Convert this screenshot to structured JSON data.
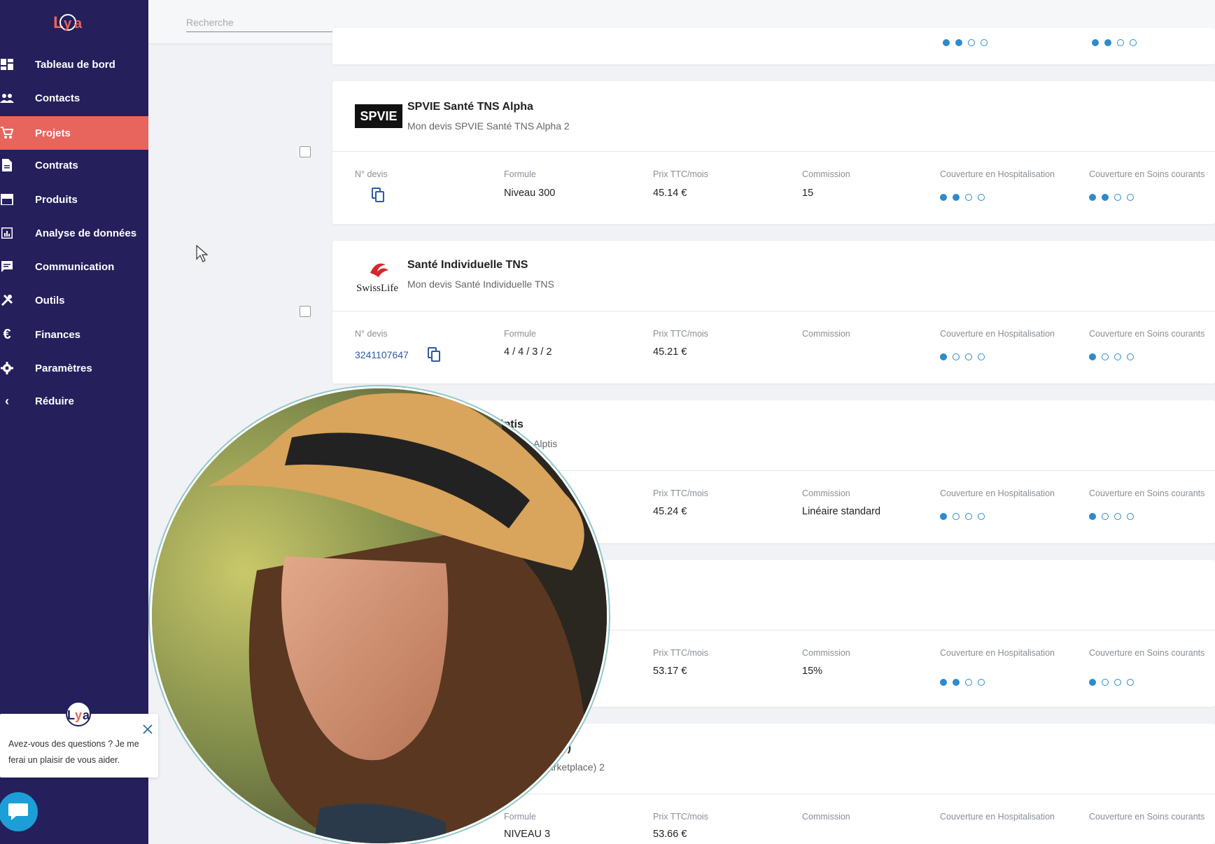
{
  "app": {
    "logo_text": "Lya"
  },
  "sidebar": {
    "items": [
      {
        "label": "Tableau de bord",
        "icon": "dashboard-icon",
        "active": false
      },
      {
        "label": "Contacts",
        "icon": "people-icon",
        "active": false
      },
      {
        "label": "Projets",
        "icon": "cart-icon",
        "active": true
      },
      {
        "label": "Contrats",
        "icon": "document-icon",
        "active": false
      },
      {
        "label": "Produits",
        "icon": "store-icon",
        "active": false
      },
      {
        "label": "Analyse de données",
        "icon": "chart-icon",
        "active": false
      },
      {
        "label": "Communication",
        "icon": "message-icon",
        "active": false
      },
      {
        "label": "Outils",
        "icon": "tools-icon",
        "active": false
      },
      {
        "label": "Finances",
        "icon": "euro-icon",
        "active": false
      },
      {
        "label": "Paramètres",
        "icon": "gear-icon",
        "active": false
      },
      {
        "label": "Réduire",
        "icon": "chevron-left-icon",
        "active": false
      }
    ]
  },
  "help": {
    "text": "Avez-vous des questions ? Je me ferai un plaisir de vous aider.",
    "logo_text": "Lya"
  },
  "search": {
    "placeholder": "Recherche"
  },
  "columns": {
    "devis": "N° devis",
    "formule": "Formule",
    "prix": "Prix TTC/mois",
    "commission": "Commission",
    "hospitalisation": "Couverture en Hospitalisation",
    "soins": "Couverture en Soins courants"
  },
  "cards": [
    {
      "brand": "SPVIE",
      "title": "SPVIE Santé TNS Alpha",
      "subtitle": "Mon devis SPVIE Santé TNS Alpha 2",
      "devis": "",
      "formule": "Niveau 300",
      "prix": "45.14 €",
      "commission": "15",
      "hospitalisation_level": 2,
      "soins_level": 2
    },
    {
      "brand": "SwissLife",
      "title": "Santé Individuelle TNS",
      "subtitle": "Mon devis Santé Individuelle TNS",
      "devis": "3241107647",
      "formule": "4 / 4 / 3 / 2",
      "prix": "45.21 €",
      "commission": "",
      "hospitalisation_level": 1,
      "soins_level": 1
    },
    {
      "title": "lptis",
      "subtitle": "Alptis",
      "prix": "45.24 €",
      "commission": "Linéaire standard",
      "hospitalisation_level": 1,
      "soins_level": 1
    },
    {
      "prix": "53.17 €",
      "commission": "15%",
      "hospitalisation_level": 2,
      "soins_level": 1
    },
    {
      "title": "ce)",
      "subtitle": "arketplace) 2",
      "formule": "NIVEAU 3",
      "prix": "53.66 €",
      "commission": ""
    }
  ]
}
